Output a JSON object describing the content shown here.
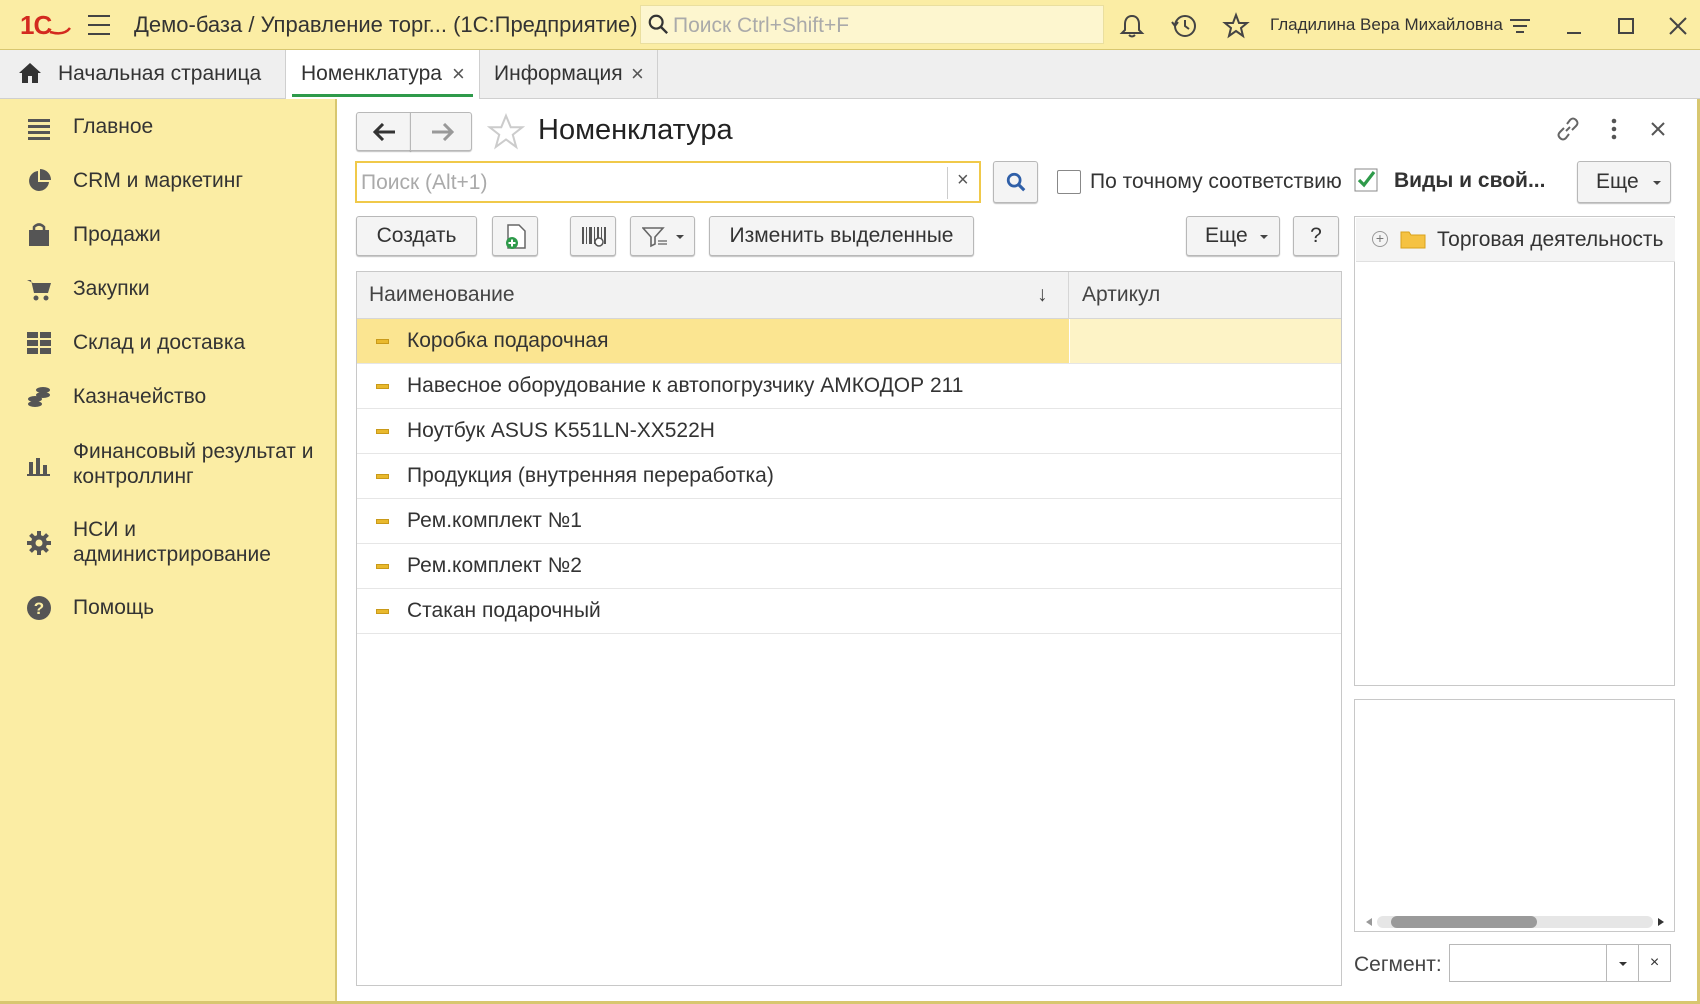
{
  "window": {
    "title": "Демо-база / Управление торг...  (1С:Предприятие)",
    "global_search_placeholder": "Поиск Ctrl+Shift+F",
    "user": "Гладилина Вера Михайловна",
    "logo": "1С"
  },
  "tabs": [
    {
      "label": "Начальная страница",
      "active": false
    },
    {
      "label": "Номенклатура",
      "active": true
    },
    {
      "label": "Информация",
      "active": false
    }
  ],
  "sidebar": {
    "items": [
      {
        "label": "Главное",
        "icon": "menu-lines-icon"
      },
      {
        "label": "CRM и маркетинг",
        "icon": "pie-chart-icon"
      },
      {
        "label": "Продажи",
        "icon": "shopping-bag-icon"
      },
      {
        "label": "Закупки",
        "icon": "cart-icon"
      },
      {
        "label": "Склад и доставка",
        "icon": "warehouse-grid-icon"
      },
      {
        "label": "Казначейство",
        "icon": "coins-icon"
      },
      {
        "label": "Финансовый результат и контроллинг",
        "icon": "bar-chart-icon"
      },
      {
        "label": "НСИ и администрирование",
        "icon": "gear-icon"
      },
      {
        "label": "Помощь",
        "icon": "question-icon"
      }
    ]
  },
  "form": {
    "title": "Номенклатура",
    "search_placeholder": "Поиск (Alt+1)",
    "exact_match_label": "По точному соответствию",
    "toolbar": {
      "create": "Создать",
      "change_selected": "Изменить выделенные",
      "more": "Еще",
      "help": "?"
    },
    "columns": {
      "name": "Наименование",
      "sort_indicator": "↓",
      "article": "Артикул"
    },
    "rows": [
      {
        "name": "Коробка подарочная",
        "article": "",
        "selected": true
      },
      {
        "name": "Навесное оборудование к автопогрузчику АМКОДОР 211",
        "article": ""
      },
      {
        "name": "Ноутбук ASUS K551LN-XX522H",
        "article": ""
      },
      {
        "name": "Продукция (внутренняя переработка)",
        "article": ""
      },
      {
        "name": "Рем.комплект №1",
        "article": ""
      },
      {
        "name": "Рем.комплект №2",
        "article": ""
      },
      {
        "name": "Стакан подарочный",
        "article": ""
      }
    ]
  },
  "right_panel": {
    "kinds_label": "Виды и свой...",
    "kinds_checked": true,
    "more": "Еще",
    "tree_items": [
      {
        "label": "Торговая деятельность"
      }
    ],
    "segment_label": "Сегмент:",
    "segment_value": ""
  },
  "colors": {
    "accent_yellow": "#fbeda4",
    "selected_row": "#fbe591",
    "active_tab_underline": "#2e9a4a",
    "logo_red": "#d32a1f"
  }
}
